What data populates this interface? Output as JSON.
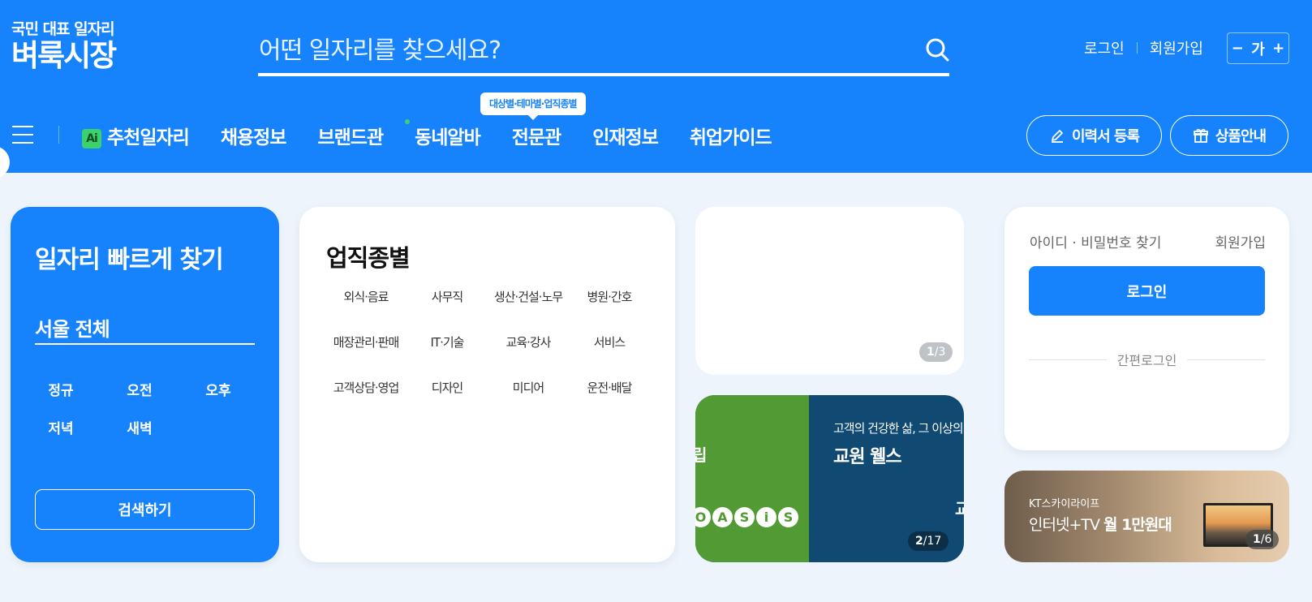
{
  "header": {
    "logo_sub": "국민 대표 일자리",
    "logo_main": "벼룩시장",
    "search_placeholder": "어떤 일자리를 찾으세요?",
    "links": {
      "login": "로그인",
      "join": "회원가입"
    },
    "font_control": {
      "minus": "−",
      "label": "가",
      "plus": "+"
    },
    "tooltip": "대상별·테마별·업직종별",
    "nav": [
      {
        "label": "추천일자리",
        "badge": "Ai"
      },
      {
        "label": "채용정보"
      },
      {
        "label": "브랜드관"
      },
      {
        "label": "동네알바"
      },
      {
        "label": "전문관"
      },
      {
        "label": "인재정보"
      },
      {
        "label": "취업가이드"
      }
    ],
    "buttons": {
      "resume": "이력서 등록",
      "products": "상품안내"
    }
  },
  "quick_find": {
    "title": "일자리 빠르게 찾기",
    "region": "서울 전체",
    "shifts": [
      "정규",
      "오전",
      "오후",
      "저녁",
      "새벽"
    ],
    "search_button": "검색하기"
  },
  "job_categories": {
    "title": "업직종별",
    "items": [
      "외식·음료",
      "사무직",
      "생산·건설·노무",
      "병원·간호",
      "매장관리·판매",
      "IT·기술",
      "교육·강사",
      "서비스",
      "고객상담·영업",
      "디자인",
      "미디어",
      "운전·배달"
    ]
  },
  "banner1": {
    "pager_current": "1",
    "pager_total": "/3"
  },
  "banner2": {
    "left_text": "립",
    "oasis_letters": [
      "O",
      "A",
      "S",
      "i",
      "S"
    ],
    "subtitle": "고객의 건강한 삶, 그 이상의",
    "title": "교원 웰스",
    "edge_text": "교",
    "pager_current": "2",
    "pager_total": "/17"
  },
  "login_box": {
    "find": "아이디 · 비밀번호 찾기",
    "join": "회원가입",
    "login_button": "로그인",
    "simple_login": "간편로그인"
  },
  "banner3": {
    "brand": "KT스카이라이프",
    "title_prefix": "인터넷+TV ",
    "title_bold": "월 1만원대",
    "pager_current": "1",
    "pager_total": "/6"
  },
  "colors": {
    "primary": "#1683fd",
    "accent_green": "#3ad36a",
    "background": "#eef4fc"
  }
}
